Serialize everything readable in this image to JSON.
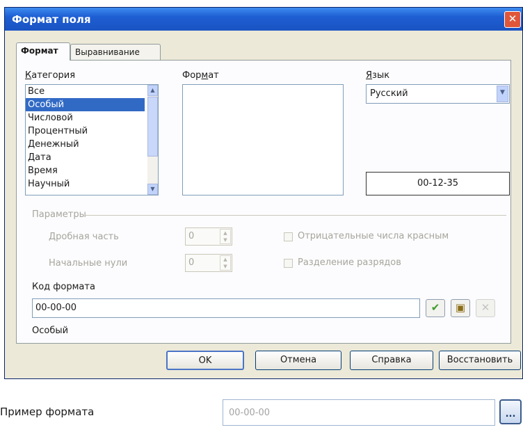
{
  "dialog": {
    "title": "Формат поля",
    "close_glyph": "✕",
    "tabs": [
      {
        "label": "Формат",
        "active": true
      },
      {
        "label": "Выравнивание",
        "active": false
      }
    ],
    "category": {
      "label": "Категория",
      "items": [
        "Все",
        "Особый",
        "Числовой",
        "Процентный",
        "Денежный",
        "Дата",
        "Время",
        "Научный"
      ],
      "selected": "Особый"
    },
    "format": {
      "label": "Формат",
      "items": []
    },
    "language": {
      "label": "Язык",
      "value": "Русский"
    },
    "preview_text": "00-12-35",
    "parameters": {
      "title": "Параметры",
      "decimal_label": "Дробная часть",
      "decimal_value": "0",
      "leading_zeros_label": "Начальные нули",
      "leading_zeros_value": "0",
      "negative_red_label": "Отрицательные числа красным",
      "thousands_sep_label": "Разделение разрядов"
    },
    "format_code": {
      "label": "Код формата",
      "value": "00-00-00"
    },
    "format_type_text": "Особый",
    "buttons": {
      "ok": "OK",
      "cancel": "Отмена",
      "help": "Справка",
      "reset": "Восстановить"
    }
  },
  "below": {
    "label": "Пример формата",
    "field_value": "00-00-00",
    "browse_glyph": "..."
  },
  "colors": {
    "titlebar": "#1e5ed3",
    "selection": "#316ac5",
    "dialog_bg": "#ece9d8"
  },
  "icons": {
    "check": "check-icon",
    "add": "add-format-icon",
    "delete": "delete-format-icon"
  }
}
